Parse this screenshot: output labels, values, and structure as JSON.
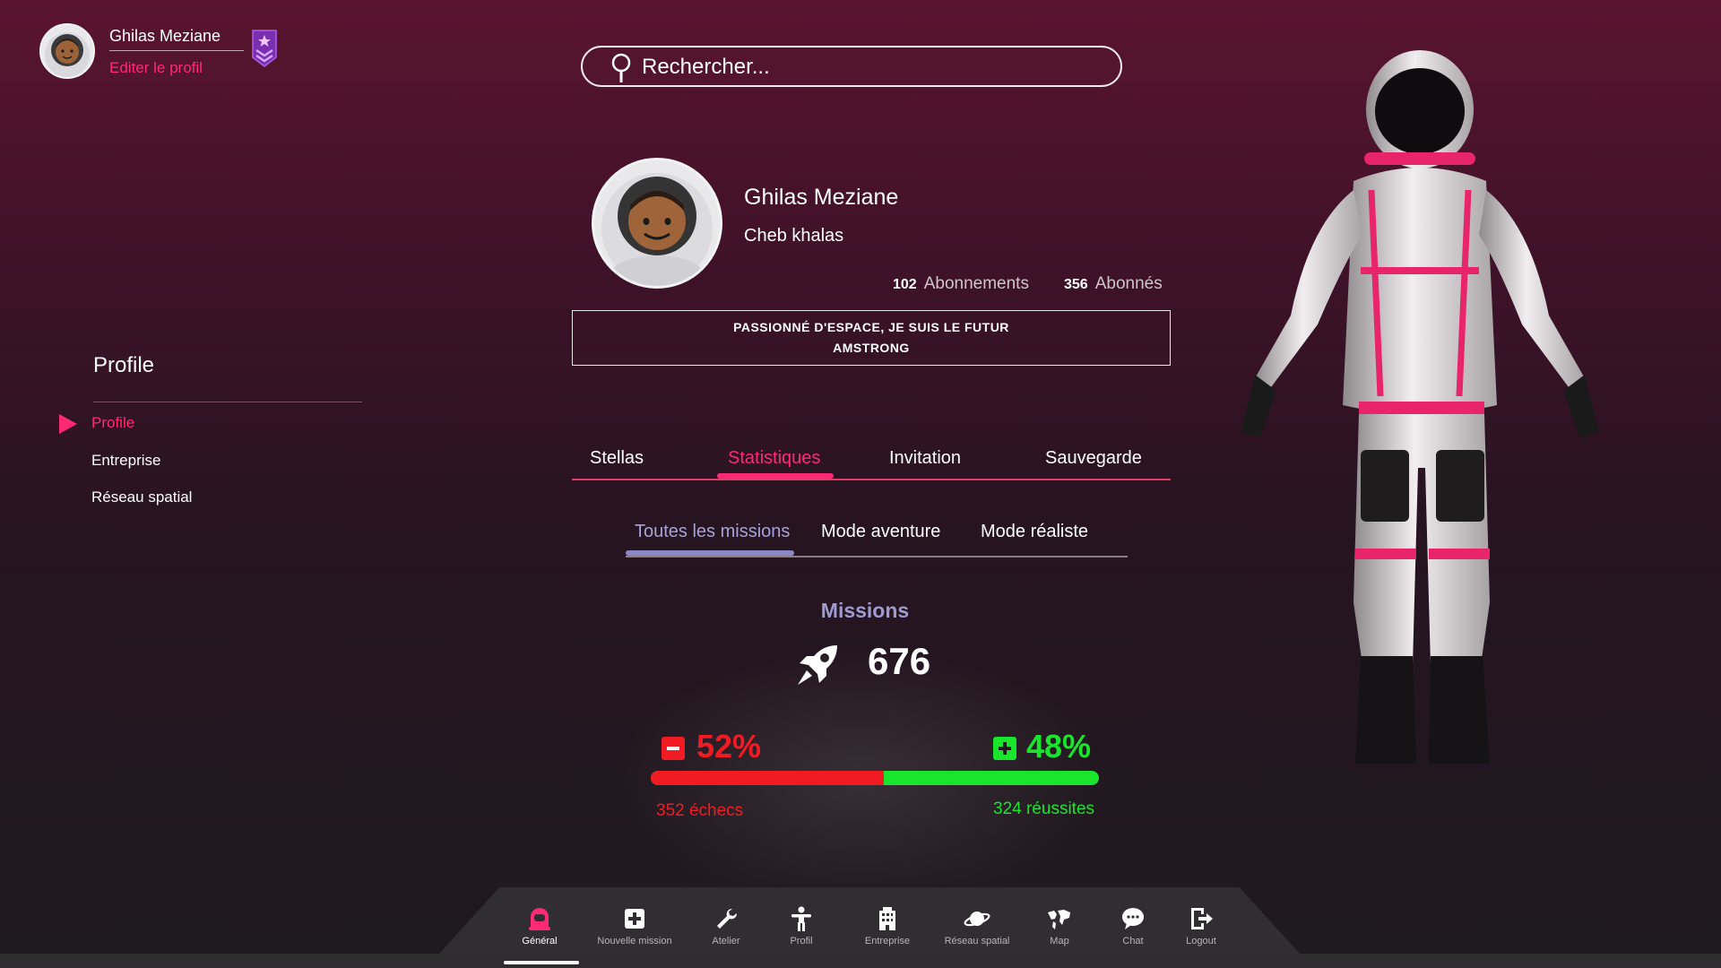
{
  "user": {
    "name": "Ghilas Meziane",
    "edit_label": "Editer le profil"
  },
  "search": {
    "placeholder": "Rechercher..."
  },
  "sidebar": {
    "title": "Profile",
    "items": [
      {
        "label": "Profile",
        "active": true
      },
      {
        "label": "Entreprise",
        "active": false
      },
      {
        "label": "Réseau spatial",
        "active": false
      }
    ]
  },
  "profile": {
    "name": "Ghilas Meziane",
    "status": "Cheb khalas",
    "subscriptions_count": "102",
    "subscriptions_label": "Abonnements",
    "followers_count": "356",
    "followers_label": "Abonnés",
    "bio": "PASSIONNÉ D'ESPACE, JE SUIS LE FUTUR AMSTRONG"
  },
  "tabs": [
    {
      "label": "Stellas",
      "active": false
    },
    {
      "label": "Statistiques",
      "active": true
    },
    {
      "label": "Invitation",
      "active": false
    },
    {
      "label": "Sauvegarde",
      "active": false
    }
  ],
  "subtabs": [
    {
      "label": "Toutes les missions",
      "active": true
    },
    {
      "label": "Mode aventure",
      "active": false
    },
    {
      "label": "Mode réaliste",
      "active": false
    }
  ],
  "missions": {
    "title": "Missions",
    "count": "676",
    "fail_percent": "52%",
    "success_percent": "48%",
    "fail_fraction": 0.52,
    "fail_label": "352 échecs",
    "success_label": "324 réussites"
  },
  "nav": [
    {
      "label": "Général",
      "icon": "astronaut-icon",
      "active": true
    },
    {
      "label": "Nouvelle mission",
      "icon": "plus-square-icon",
      "active": false
    },
    {
      "label": "Atelier",
      "icon": "wrench-icon",
      "active": false
    },
    {
      "label": "Profil",
      "icon": "person-icon",
      "active": false
    },
    {
      "label": "Entreprise",
      "icon": "building-icon",
      "active": false
    },
    {
      "label": "Réseau spatial",
      "icon": "planet-icon",
      "active": false
    },
    {
      "label": "Map",
      "icon": "world-map-icon",
      "active": false
    },
    {
      "label": "Chat",
      "icon": "chat-bubble-icon",
      "active": false
    },
    {
      "label": "Logout",
      "icon": "logout-icon",
      "active": false
    }
  ],
  "colors": {
    "accent": "#ff2a73",
    "fail": "#f11b24",
    "success": "#18e52b",
    "subtab_accent": "#a7a3d6"
  }
}
